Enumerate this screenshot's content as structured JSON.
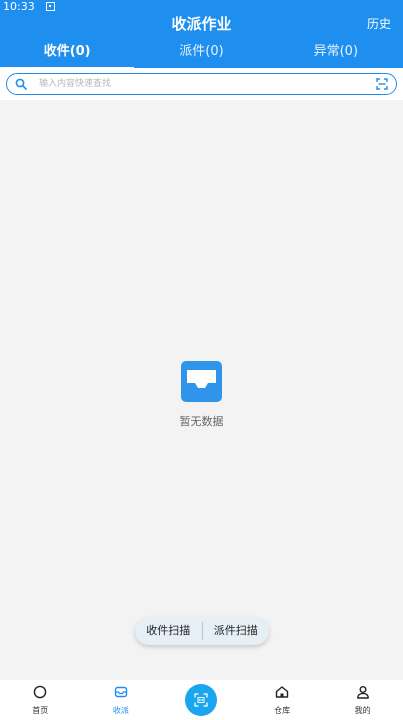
{
  "status_bar": {
    "time": "10:33"
  },
  "header": {
    "title": "收派作业",
    "history_label": "历史"
  },
  "tabs": [
    {
      "label": "收件(0)",
      "active": true
    },
    {
      "label": "派件(0)",
      "active": false
    },
    {
      "label": "异常(0)",
      "active": false
    }
  ],
  "search": {
    "placeholder": "输入内容快速查找",
    "value": ""
  },
  "empty_state": {
    "text": "暂无数据"
  },
  "scan_actions": {
    "receive_label": "收件扫描",
    "dispatch_label": "派件扫描"
  },
  "bottom_nav": [
    {
      "label": "首页",
      "icon": "circle-icon",
      "active": false
    },
    {
      "label": "收派",
      "icon": "inbox-icon",
      "active": true
    },
    {
      "label": "",
      "icon": "scan-icon",
      "active": false
    },
    {
      "label": "仓库",
      "icon": "warehouse-icon",
      "active": false
    },
    {
      "label": "我的",
      "icon": "person-icon",
      "active": false
    }
  ],
  "colors": {
    "primary": "#1e8fef",
    "background": "#f3f3f3",
    "scan_button": "#1aa5f0"
  }
}
